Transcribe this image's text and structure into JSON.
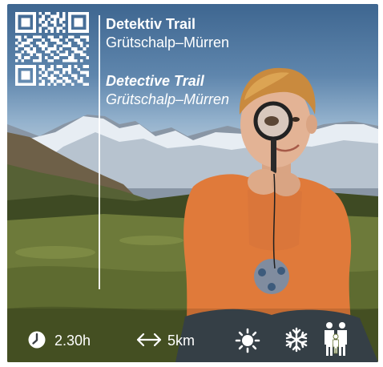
{
  "title": {
    "de_name": "Detektiv Trail",
    "de_route": "Grütschalp–Mürren",
    "en_name": "Detective Trail",
    "en_route": "Grütschalp–Mürren"
  },
  "info": {
    "duration": "2.30h",
    "distance": "5km"
  },
  "icons": {
    "clock": "clock-icon",
    "distance": "double-arrow-icon",
    "summer": "sun-icon",
    "winter": "snowflake-icon",
    "family": "family-icon",
    "qr": "qr-code"
  },
  "colors": {
    "text": "#ffffff",
    "sky": "#4f78a0"
  }
}
